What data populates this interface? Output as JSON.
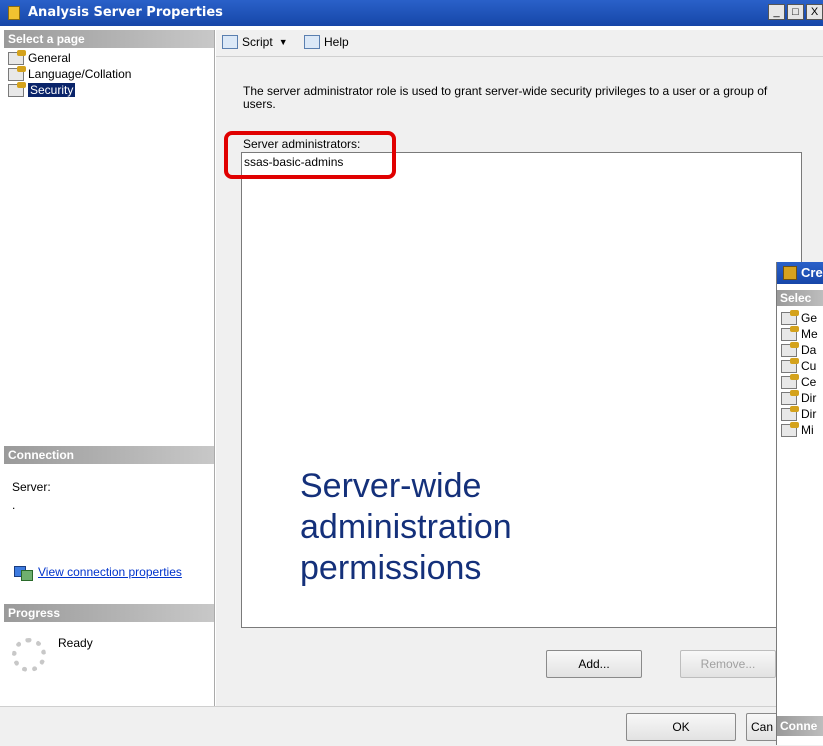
{
  "window": {
    "title": "Analysis Server Properties",
    "minimize_label": "_",
    "maximize_label": "□",
    "close_label": "X"
  },
  "left_pane": {
    "select_page_header": "Select a page",
    "pages": [
      {
        "label": "General",
        "selected": false
      },
      {
        "label": "Language/Collation",
        "selected": false
      },
      {
        "label": "Security",
        "selected": true
      }
    ],
    "connection_header": "Connection",
    "server_label": "Server:",
    "server_value": ".",
    "view_connection_link": "View connection properties",
    "progress_header": "Progress",
    "progress_status": "Ready"
  },
  "toolbar": {
    "script_label": "Script",
    "help_label": "Help"
  },
  "main": {
    "description": "The server administrator role is used to grant server-wide security privileges to a user or a group of users.",
    "admins_label": "Server administrators:",
    "admins": [
      "ssas-basic-admins"
    ],
    "overlay_lines": [
      "Server-wide",
      "administration",
      "permissions"
    ],
    "add_button": "Add...",
    "remove_button": "Remove..."
  },
  "bottom": {
    "ok_button": "OK",
    "cancel_button": "Can"
  },
  "second_window": {
    "title": "Cre",
    "select_header": "Selec",
    "pages": [
      "Ge",
      "Me",
      "Da",
      "Cu",
      "Ce",
      "Dir",
      "Dir",
      "Mi"
    ],
    "connection_header": "Conne"
  },
  "colors": {
    "titlebar": "#1f56bb",
    "highlight_border": "#e00000",
    "overlay_text": "#14307a",
    "link": "#0033cc",
    "selection": "#0a246a"
  }
}
